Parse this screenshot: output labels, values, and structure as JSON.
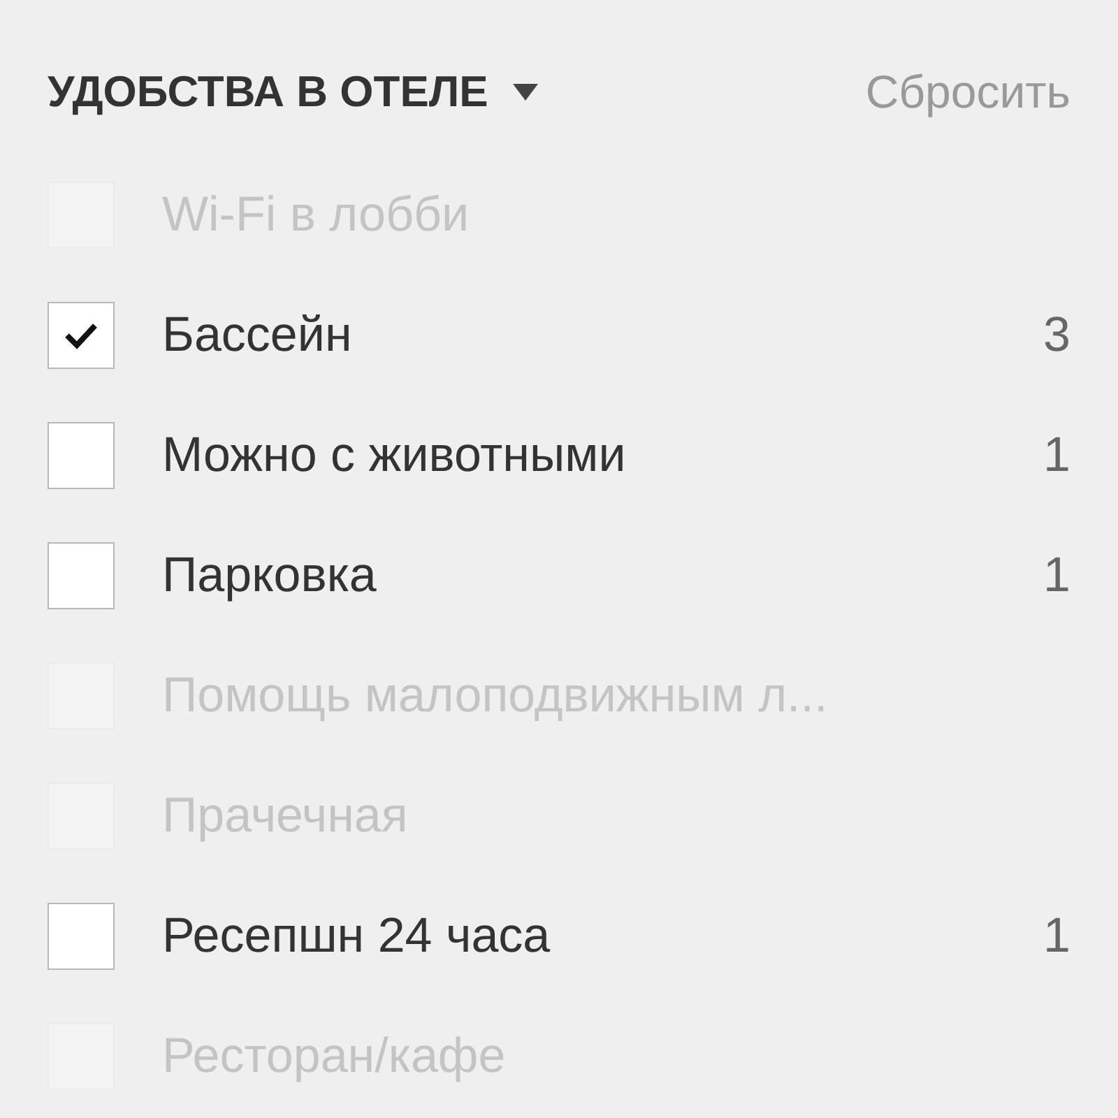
{
  "filter": {
    "title": "УДОБСТВА В ОТЕЛЕ",
    "expanded": true,
    "reset": "Сбросить",
    "items": [
      {
        "label": "Wi-Fi в лобби",
        "checked": false,
        "disabled": true
      },
      {
        "label": "Бассейн",
        "checked": true,
        "disabled": false,
        "count": "3"
      },
      {
        "label": "Можно с животными",
        "checked": false,
        "disabled": false,
        "count": "1"
      },
      {
        "label": "Парковка",
        "checked": false,
        "disabled": false,
        "count": "1"
      },
      {
        "label": "Помощь малоподвижным л...",
        "checked": false,
        "disabled": true
      },
      {
        "label": "Прачечная",
        "checked": false,
        "disabled": true
      },
      {
        "label": "Ресепшн 24 часа",
        "checked": false,
        "disabled": false,
        "count": "1"
      },
      {
        "label": "Ресторан/кафе",
        "checked": false,
        "disabled": true
      }
    ]
  }
}
